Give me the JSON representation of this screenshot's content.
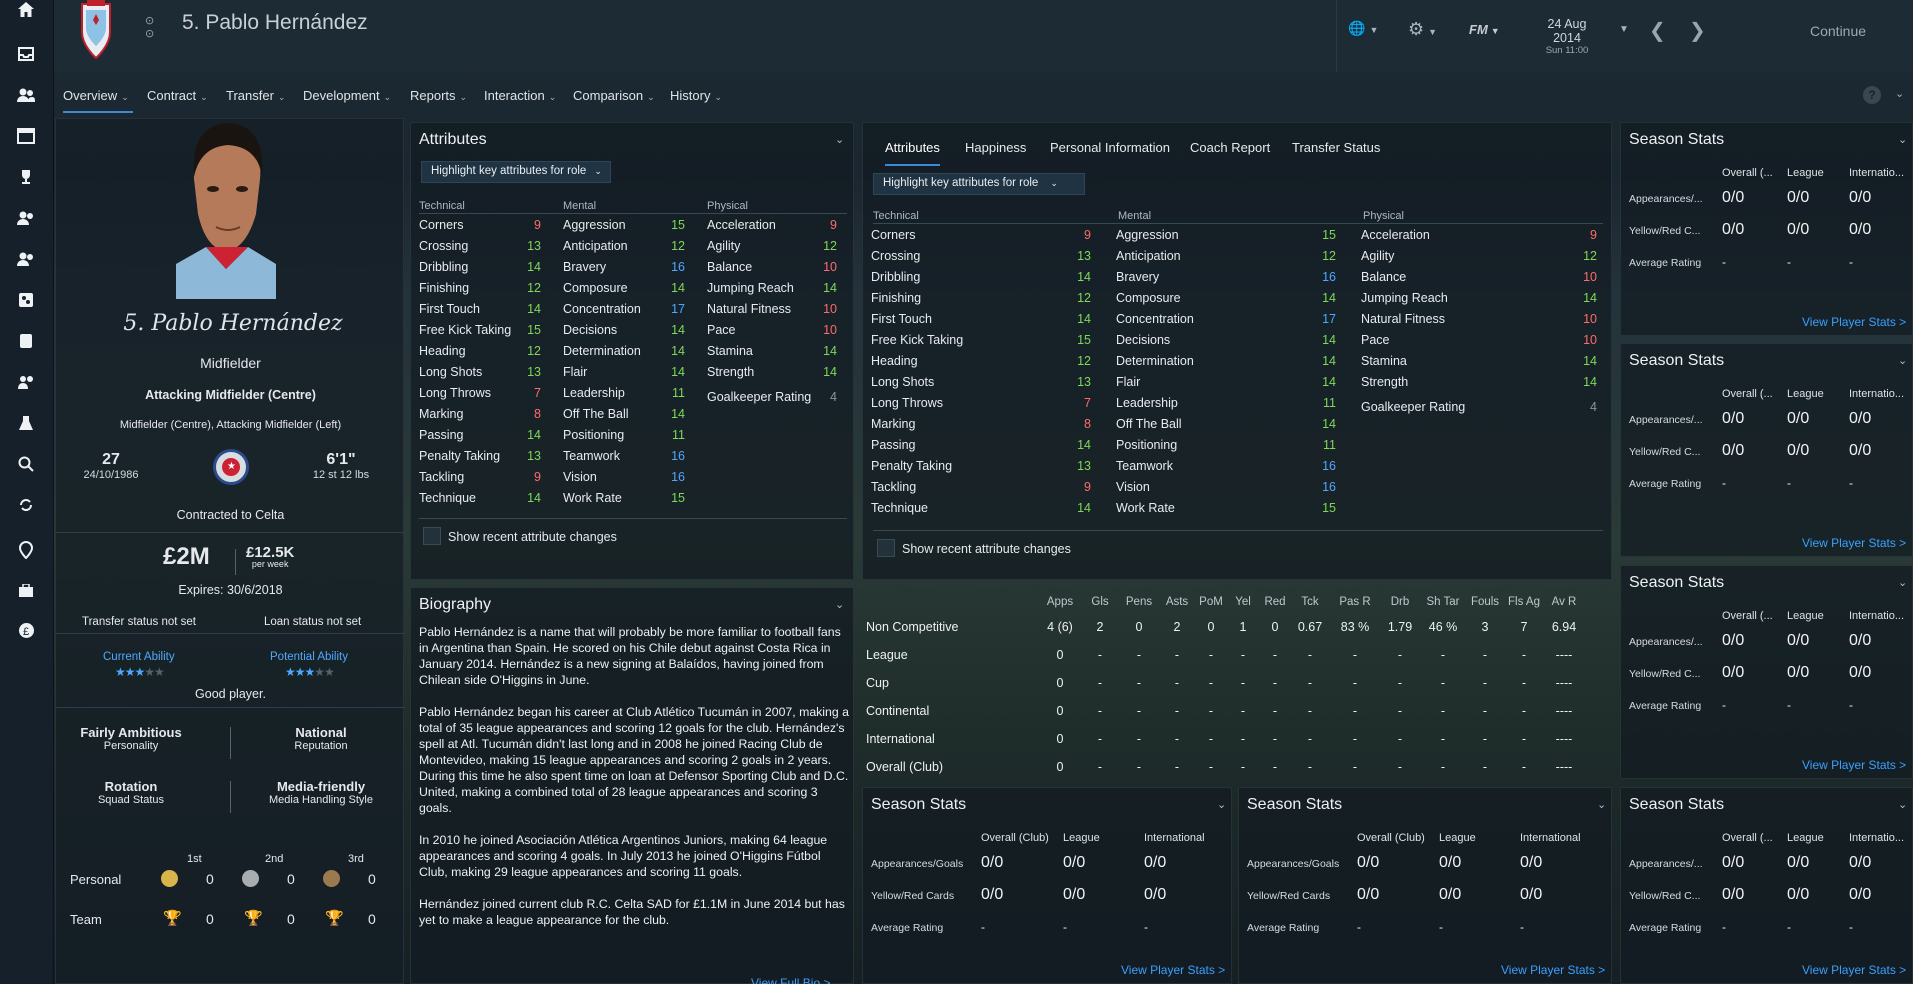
{
  "header": {
    "title": "5. Pablo Hernández",
    "date": "24 Aug 2014",
    "time": "Sun 11:00",
    "continue_label": "Continue",
    "fm_label": "FM"
  },
  "nav": [
    "Overview",
    "Contract",
    "Transfer",
    "Development",
    "Reports",
    "Interaction",
    "Comparison",
    "History"
  ],
  "profile": {
    "signature": "5. Pablo Hernández",
    "position": "Midfielder",
    "role": "Attacking Midfielder (Centre)",
    "positions": "Midfielder (Centre), Attacking Midfielder (Left)",
    "age": "27",
    "dob": "24/10/1986",
    "height": "6'1\"",
    "weight": "12 st 12 lbs",
    "contract": "Contracted to Celta",
    "value": "£2M",
    "wage": "£12.5K",
    "wage_unit": "per week",
    "expires": "Expires: 30/6/2018",
    "transfer_status": "Transfer status not set",
    "loan_status": "Loan status not set",
    "ca_label": "Current Ability",
    "pa_label": "Potential Ability",
    "ca_stars": "★★★★★",
    "pa_stars": "★★★★★",
    "assessment": "Good player.",
    "personality": "Fairly Ambitious",
    "personality_lbl": "Personality",
    "reputation": "National",
    "reputation_lbl": "Reputation",
    "squad_status": "Rotation",
    "squad_status_lbl": "Squad Status",
    "media": "Media-friendly",
    "media_lbl": "Media Handling Style",
    "awards": {
      "h1": "1st",
      "h2": "2nd",
      "h3": "3rd",
      "personal": "Personal",
      "team": "Team",
      "p1": "0",
      "p2": "0",
      "p3": "0",
      "t1": "0",
      "t2": "0",
      "t3": "0"
    }
  },
  "attributes": {
    "title": "Attributes",
    "highlight": "Highlight key attributes for role",
    "technical": "Technical",
    "mental": "Mental",
    "physical": "Physical",
    "show_recent": "Show recent attribute changes",
    "tech": [
      [
        "Corners",
        "9",
        "r"
      ],
      [
        "Crossing",
        "13",
        "g"
      ],
      [
        "Dribbling",
        "14",
        "g"
      ],
      [
        "Finishing",
        "12",
        "g"
      ],
      [
        "First Touch",
        "14",
        "g"
      ],
      [
        "Free Kick Taking",
        "15",
        "g"
      ],
      [
        "Heading",
        "12",
        "g"
      ],
      [
        "Long Shots",
        "13",
        "g"
      ],
      [
        "Long Throws",
        "7",
        "r"
      ],
      [
        "Marking",
        "8",
        "r"
      ],
      [
        "Passing",
        "14",
        "g"
      ],
      [
        "Penalty Taking",
        "13",
        "g"
      ],
      [
        "Tackling",
        "9",
        "r"
      ],
      [
        "Technique",
        "14",
        "g"
      ]
    ],
    "ment": [
      [
        "Aggression",
        "15",
        "g"
      ],
      [
        "Anticipation",
        "12",
        "g"
      ],
      [
        "Bravery",
        "16",
        "b"
      ],
      [
        "Composure",
        "14",
        "g"
      ],
      [
        "Concentration",
        "17",
        "b"
      ],
      [
        "Decisions",
        "14",
        "g"
      ],
      [
        "Determination",
        "14",
        "g"
      ],
      [
        "Flair",
        "14",
        "g"
      ],
      [
        "Leadership",
        "11",
        "g"
      ],
      [
        "Off The Ball",
        "14",
        "g"
      ],
      [
        "Positioning",
        "11",
        "g"
      ],
      [
        "Teamwork",
        "16",
        "b"
      ],
      [
        "Vision",
        "16",
        "b"
      ],
      [
        "Work Rate",
        "15",
        "g"
      ]
    ],
    "phys": [
      [
        "Acceleration",
        "9",
        "r"
      ],
      [
        "Agility",
        "12",
        "g"
      ],
      [
        "Balance",
        "10",
        "r"
      ],
      [
        "Jumping Reach",
        "14",
        "g"
      ],
      [
        "Natural Fitness",
        "10",
        "r"
      ],
      [
        "Pace",
        "10",
        "r"
      ],
      [
        "Stamina",
        "14",
        "g"
      ],
      [
        "Strength",
        "14",
        "g"
      ]
    ],
    "gk": [
      "Goalkeeper Rating",
      "4"
    ]
  },
  "tabs": [
    "Attributes",
    "Happiness",
    "Personal Information",
    "Coach Report",
    "Transfer Status"
  ],
  "biography": {
    "title": "Biography",
    "paragraphs": [
      "Pablo Hernández is a name that will probably be more familiar to football fans in Argentina than Spain. He scored on his Chile debut against Costa Rica in January 2014. Hernández is a new signing at Balaídos, having joined from Chilean side O'Higgins in June.",
      "Pablo Hernández began his career at Club Atlético Tucumán in 2007, making a total of 35 league appearances and scoring 12 goals for the club. Hernández's spell at Atl. Tucumán didn't last long and in 2008 he joined Racing Club de Montevideo, making 15 league appearances and scoring 2 goals in 2 years. During this time he also spent time on loan at Defensor Sporting Club and D.C. United, making a combined total of 28 league appearances and scoring 3 goals.",
      "In 2010 he joined Asociación Atlética Argentinos Juniors, making 64 league appearances and scoring 4 goals. In July 2013 he joined O'Higgins Fútbol Club, making 29 league appearances and scoring 11 goals.",
      "Hernández joined current club R.C. Celta SAD for £1.1M in June 2014 but has yet to make a league appearance for the club."
    ],
    "link": "View Full Bio >"
  },
  "stats_table": {
    "headers": [
      "Apps",
      "Gls",
      "Pens",
      "Asts",
      "PoM",
      "Yel",
      "Red",
      "Tck",
      "Pas R",
      "Drb",
      "Sh Tar",
      "Fouls",
      "Fls Ag",
      "Av R"
    ],
    "rows": [
      [
        "Non Competitive",
        "4 (6)",
        "2",
        "0",
        "2",
        "0",
        "1",
        "0",
        "0.67",
        "83 %",
        "1.79",
        "46 %",
        "3",
        "7",
        "6.94"
      ],
      [
        "League",
        "0",
        "-",
        "-",
        "-",
        "-",
        "-",
        "-",
        "-",
        "-",
        "-",
        "-",
        "-",
        "-",
        "----"
      ],
      [
        "Cup",
        "0",
        "-",
        "-",
        "-",
        "-",
        "-",
        "-",
        "-",
        "-",
        "-",
        "-",
        "-",
        "-",
        "----"
      ],
      [
        "Continental",
        "0",
        "-",
        "-",
        "-",
        "-",
        "-",
        "-",
        "-",
        "-",
        "-",
        "-",
        "-",
        "-",
        "----"
      ],
      [
        "International",
        "0",
        "-",
        "-",
        "-",
        "-",
        "-",
        "-",
        "-",
        "-",
        "-",
        "-",
        "-",
        "-",
        "----"
      ],
      [
        "Overall (Club)",
        "0",
        "-",
        "-",
        "-",
        "-",
        "-",
        "-",
        "-",
        "-",
        "-",
        "-",
        "-",
        "-",
        "----"
      ]
    ]
  },
  "season": {
    "title": "Season Stats",
    "col1": "Overall (Club)",
    "col1_short": "Overall (...",
    "col2": "League",
    "col3": "International",
    "col3_short": "Internatio...",
    "row1": "Appearances/Goals",
    "row1_short": "Appearances/...",
    "row2": "Yellow/Red Cards",
    "row2_short": "Yellow/Red C...",
    "row3": "Average Rating",
    "val": "0/0",
    "dash": "-",
    "link": "View Player Stats >"
  }
}
